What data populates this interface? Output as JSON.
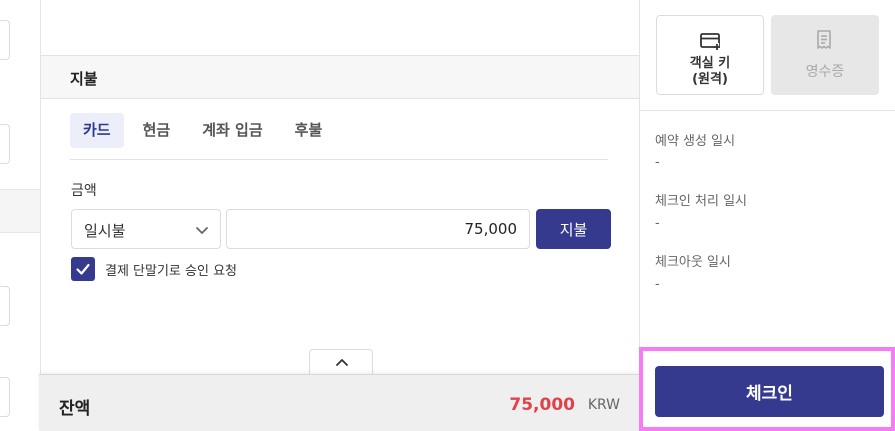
{
  "payment": {
    "section_title": "지불",
    "tabs": [
      {
        "label": "카드",
        "active": true
      },
      {
        "label": "현금",
        "active": false
      },
      {
        "label": "계좌 입금",
        "active": false
      },
      {
        "label": "후불",
        "active": false
      }
    ],
    "amount_label": "금액",
    "installment_select": {
      "value": "일시불"
    },
    "amount_input": {
      "value": "75,000"
    },
    "pay_button_label": "지불",
    "terminal_approval": {
      "label": "결제 단말기로 승인 요청",
      "checked": true
    }
  },
  "balance": {
    "label": "잔액",
    "amount": "75,000",
    "currency": "KRW"
  },
  "side": {
    "room_key_button": {
      "label": "객실 키\n(원격)",
      "icon": "key-card-add-icon"
    },
    "receipt_button": {
      "label": "영수증",
      "icon": "receipt-icon",
      "disabled": true
    },
    "info": [
      {
        "label": "예약 생성 일시",
        "value": "-"
      },
      {
        "label": "체크인 처리 일시",
        "value": "-"
      },
      {
        "label": "체크아웃 일시",
        "value": "-"
      }
    ],
    "checkin_button_label": "체크인"
  },
  "colors": {
    "primary": "#363a8f",
    "active_tab_bg": "#eceefa",
    "balance_amount": "#e0424a",
    "highlight": "#f57cf5"
  }
}
